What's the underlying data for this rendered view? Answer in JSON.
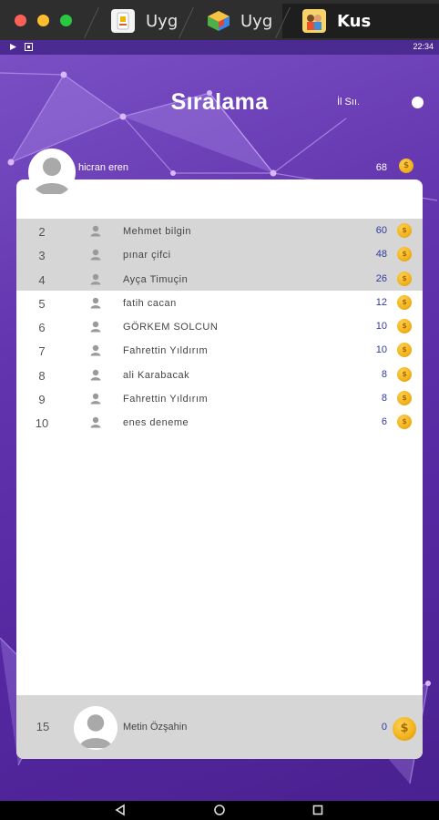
{
  "window": {
    "tabs": [
      {
        "label": "Uyg",
        "icon": "app-icon"
      },
      {
        "label": "Uyg",
        "icon": "bluestacks-icon"
      },
      {
        "label": "Kus",
        "icon": "kids-app-icon"
      }
    ]
  },
  "statusbar": {
    "time": "22:34"
  },
  "header": {
    "title": "Sıralama",
    "toggle_label": "İl Sıı."
  },
  "current_user": {
    "name": "hicran eren",
    "score": "68"
  },
  "leaderboard": {
    "rows": [
      {
        "rank": "2",
        "name": "Mehmet  bilgin",
        "score": "60"
      },
      {
        "rank": "3",
        "name": "pınar  çifci",
        "score": "48"
      },
      {
        "rank": "4",
        "name": "Ayça Timuçin",
        "score": "26"
      },
      {
        "rank": "5",
        "name": "fatih cacan",
        "score": "12"
      },
      {
        "rank": "6",
        "name": "GÖRKEM  SOLCUN",
        "score": "10"
      },
      {
        "rank": "7",
        "name": "Fahrettin  Yıldırım",
        "score": "10"
      },
      {
        "rank": "8",
        "name": "ali Karabacak",
        "score": "8"
      },
      {
        "rank": "9",
        "name": "Fahrettin  Yıldırım",
        "score": "8"
      },
      {
        "rank": "10",
        "name": "enes deneme",
        "score": "6"
      }
    ],
    "highlighted_ranks": [
      "2",
      "3",
      "4"
    ]
  },
  "footer_user": {
    "rank": "15",
    "name": "Metin Özşahin",
    "score": "0"
  },
  "coin_symbol": "$",
  "colors": {
    "accent_purple": "#6234ad",
    "score_blue": "#2e3a9e",
    "coin_gold": "#f3b51d",
    "highlight_row": "#d6d6d6"
  }
}
